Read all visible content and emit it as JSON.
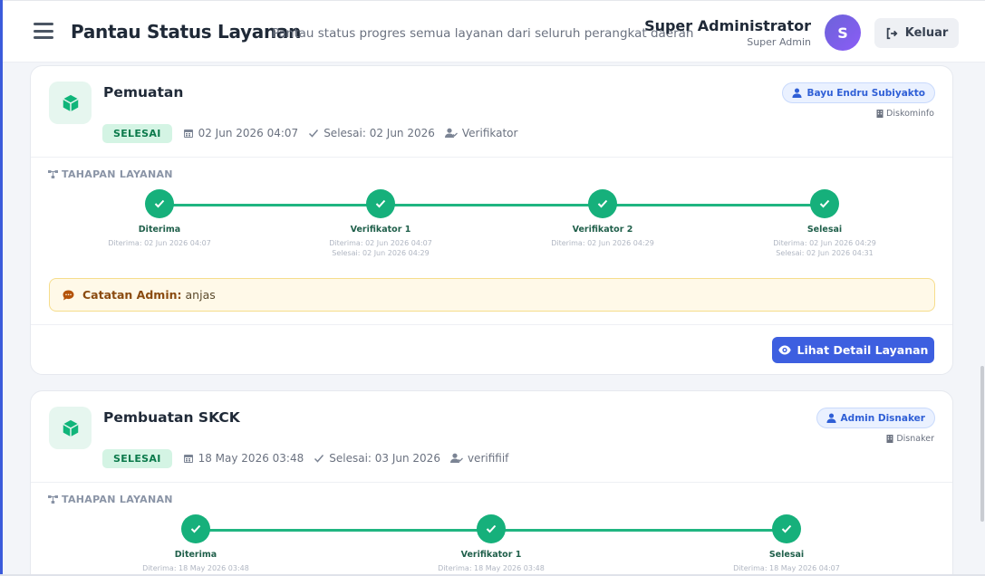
{
  "header": {
    "title": "Pantau Status Layanan",
    "subtitle": "Pantau status progres semua layanan dari seluruh perangkat daerah",
    "user_name": "Super Administrator",
    "user_role": "Super Admin",
    "avatar_initial": "S",
    "logout_label": "Keluar",
    "icons": {
      "menu": "hamburger-icon",
      "logout": "logout-icon"
    }
  },
  "tahapan_label": "TAHAPAN LAYANAN",
  "colors": {
    "accent": "#3d5fe0",
    "success": "#16b07b",
    "badge_bg": "#d4f4e4",
    "note_bg": "#fff9e8"
  },
  "services": [
    {
      "title": "Pemuatan",
      "status": "SELESAI",
      "date": "02 Jun 2026 04:07",
      "finished": "Selesai: 02 Jun 2026",
      "verifier": "Verifikator",
      "assignee": "Bayu Endru Subiyakto",
      "department": "Diskominfo",
      "steps": [
        {
          "label": "Diterima",
          "lines": [
            "Diterima: 02 Jun 2026 04:07"
          ]
        },
        {
          "label": "Verifikator 1",
          "lines": [
            "Diterima: 02 Jun 2026 04:07",
            "Selesai: 02 Jun 2026 04:29"
          ]
        },
        {
          "label": "Verifikator 2",
          "lines": [
            "Diterima: 02 Jun 2026 04:29"
          ]
        },
        {
          "label": "Selesai",
          "lines": [
            "Diterima: 02 Jun 2026 04:29",
            "Selesai: 02 Jun 2026 04:31"
          ]
        }
      ],
      "note_label": "Catatan Admin:",
      "note_text": "anjas",
      "detail_label": "Lihat Detail Layanan"
    },
    {
      "title": "Pembuatan SKCK",
      "status": "SELESAI",
      "date": "18 May 2026 03:48",
      "finished": "Selesai: 03 Jun 2026",
      "verifier": "verififiif",
      "assignee": "Admin Disnaker",
      "department": "Disnaker",
      "steps": [
        {
          "label": "Diterima",
          "lines": [
            "Diterima: 18 May 2026 03:48"
          ]
        },
        {
          "label": "Verifikator 1",
          "lines": [
            "Diterima: 18 May 2026 03:48"
          ]
        },
        {
          "label": "Selesai",
          "lines": [
            "Diterima: 18 May 2026 04:07"
          ]
        }
      ]
    }
  ]
}
